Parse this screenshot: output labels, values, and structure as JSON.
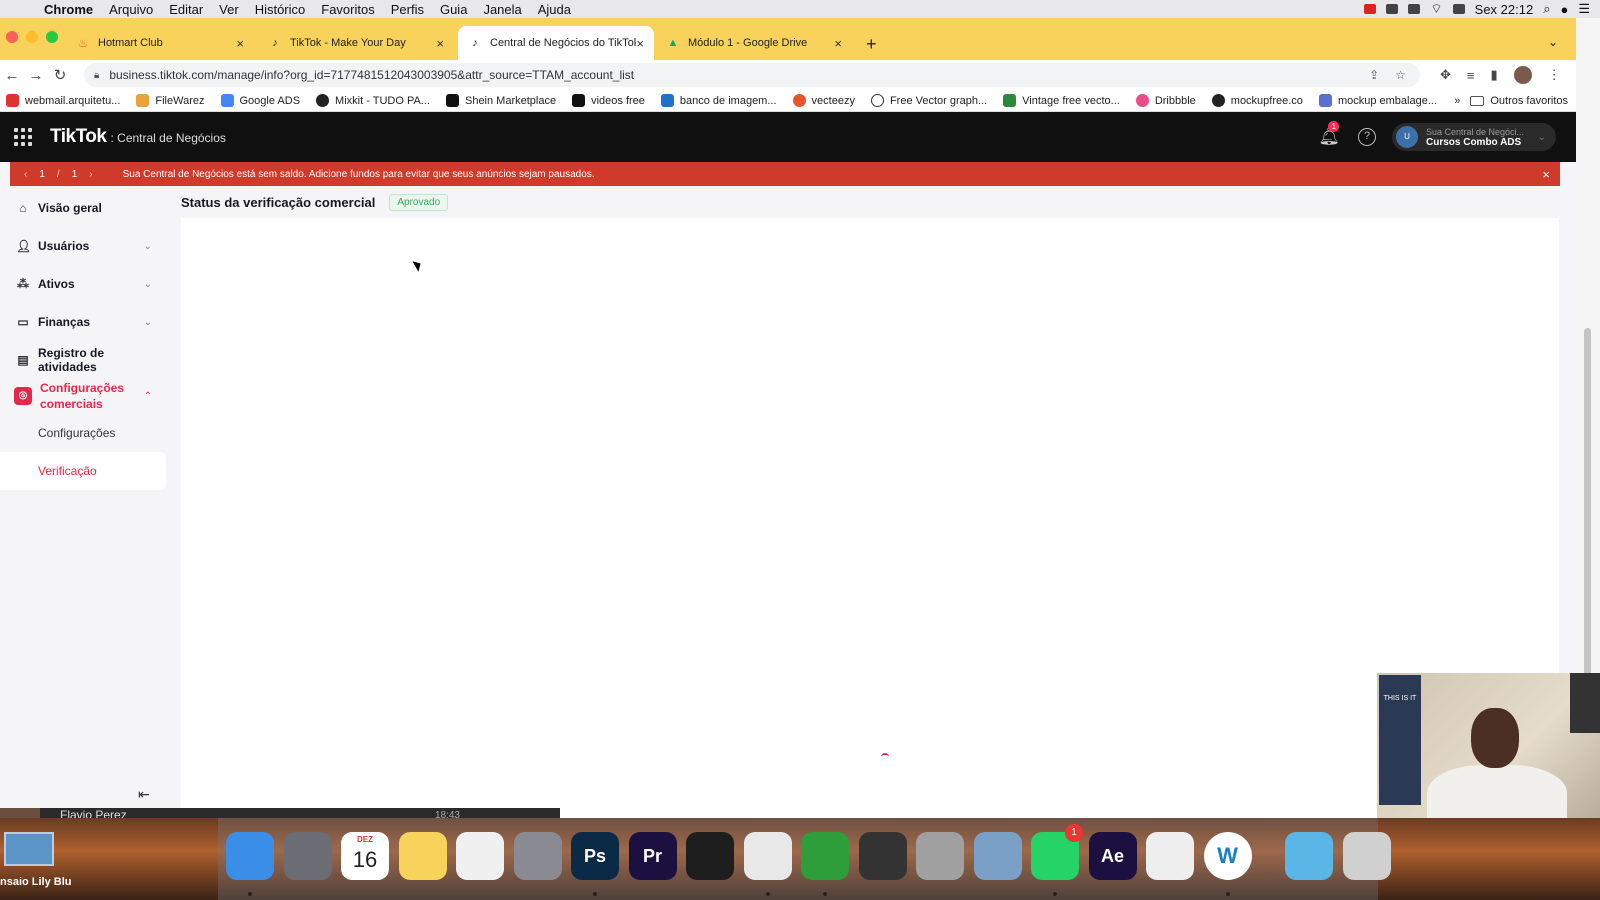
{
  "menubar": {
    "app": "Chrome",
    "items": [
      "Arquivo",
      "Editar",
      "Ver",
      "Histórico",
      "Favoritos",
      "Perfis",
      "Guia",
      "Janela",
      "Ajuda"
    ],
    "clock": "Sex 22:12"
  },
  "tabs": [
    {
      "title": "Hotmart Club",
      "icon": "flame-icon",
      "color": "#e8542a"
    },
    {
      "title": "TikTok - Make Your Day",
      "icon": "tiktok-icon",
      "color": "#111111"
    },
    {
      "title": "Central de Negócios do TikTok",
      "icon": "tiktok-icon",
      "color": "#111111"
    },
    {
      "title": "Módulo 1 - Google Drive",
      "icon": "drive-icon",
      "color": "#1fa463"
    }
  ],
  "address": {
    "url": "business.tiktok.com/manage/info?org_id=7177481512043003905&attr_source=TTAM_account_list"
  },
  "bookmarks": [
    {
      "label": "webmail.arquitetu...",
      "color": "#d33"
    },
    {
      "label": "FileWarez",
      "color": "#e8a33d"
    },
    {
      "label": "Google ADS",
      "color": "#4285f4"
    },
    {
      "label": "Mixkit - TUDO PA...",
      "color": "#222"
    },
    {
      "label": "Shein Marketplace",
      "color": "#111"
    },
    {
      "label": "videos free",
      "color": "#111"
    },
    {
      "label": "banco de imagem...",
      "color": "#1e73c8"
    },
    {
      "label": "vecteezy",
      "color": "#e8542a"
    },
    {
      "label": "Free Vector graph...",
      "color": "#333"
    },
    {
      "label": "Vintage free vecto...",
      "color": "#2a8a3a"
    },
    {
      "label": "Dribbble",
      "color": "#ea4c89"
    },
    {
      "label": "mockupfree.co",
      "color": "#222"
    },
    {
      "label": "mockup embalage...",
      "color": "#5a6fd0"
    }
  ],
  "bookmarks_more": "»",
  "bookmarks_other": "Outros favoritos",
  "header": {
    "logo": "TikTok",
    "logo_sub": ": Central de Negócios",
    "notif_count": "1",
    "account_line1": "Sua Central de Negóci...",
    "account_line2": "Cursos Combo ADS",
    "account_initial": "U"
  },
  "alert": {
    "page_current": "1",
    "page_sep": "/",
    "page_total": "1",
    "message": "Sua Central de Negócios está sem saldo. Adicione fundos para evitar que seus anúncios sejam pausados."
  },
  "sidebar": {
    "items": [
      {
        "label": "Visão geral"
      },
      {
        "label": "Usuários"
      },
      {
        "label": "Ativos"
      },
      {
        "label": "Finanças"
      },
      {
        "label": "Registro de atividades"
      },
      {
        "label": "Configurações comerciais"
      }
    ],
    "sub": [
      "Configurações",
      "Verificação"
    ]
  },
  "main": {
    "title": "Status da verificação comercial",
    "badge": "Aprovado"
  },
  "dock": {
    "left_label": "nsaio Lily Blu",
    "calendar_month": "DEZ",
    "calendar_day": "16",
    "whatsapp_badge": "1",
    "apps": [
      {
        "name": "finder",
        "label": "",
        "color": "#3a8ee8"
      },
      {
        "name": "launchpad",
        "label": "",
        "color": "#6c6c74"
      },
      {
        "name": "calendar",
        "label": "",
        "color": "#ffffff"
      },
      {
        "name": "notes",
        "label": "",
        "color": "#f7d35c"
      },
      {
        "name": "photos",
        "label": "",
        "color": "#f0f0f0"
      },
      {
        "name": "system-preferences",
        "label": "",
        "color": "#8a8a92"
      },
      {
        "name": "photoshop",
        "label": "Ps",
        "color": "#0b2a45"
      },
      {
        "name": "premiere",
        "label": "Pr",
        "color": "#1b1040"
      },
      {
        "name": "vectornator",
        "label": "",
        "color": "#1e1e1e"
      },
      {
        "name": "chrome",
        "label": "",
        "color": "#e8e8e8"
      },
      {
        "name": "camtasia",
        "label": "",
        "color": "#2e9e3a"
      },
      {
        "name": "fan-control",
        "label": "",
        "color": "#333333"
      },
      {
        "name": "calculator",
        "label": "",
        "color": "#a0a0a0"
      },
      {
        "name": "preview",
        "label": "",
        "color": "#7aa0c8"
      },
      {
        "name": "whatsapp",
        "label": "",
        "color": "#25d366"
      },
      {
        "name": "after-effects",
        "label": "Ae",
        "color": "#1b1040"
      },
      {
        "name": "textedit",
        "label": "",
        "color": "#eeeeee"
      },
      {
        "name": "webex",
        "label": "W",
        "color": "#ffffff"
      },
      {
        "name": "files",
        "label": "",
        "color": "#5bb6e8"
      },
      {
        "name": "trash",
        "label": "",
        "color": "#d0d0d0"
      }
    ]
  },
  "userstrip": {
    "name": "Flavio Perez",
    "time": "18:43"
  },
  "webcam": {
    "poster_text": "THIS IS IT"
  }
}
